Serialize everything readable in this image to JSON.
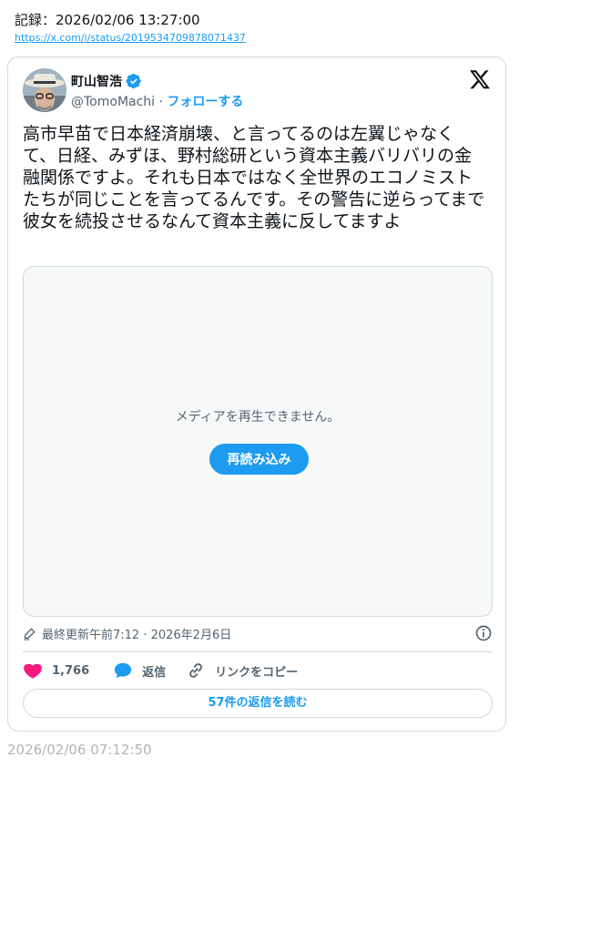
{
  "record": {
    "header": "記録：2026/02/06 13:27:00",
    "url": "https://x.com/i/status/2019534709878071437"
  },
  "tweet": {
    "author_name": "町山智浩",
    "handle": "@TomoMachi",
    "separator": "·",
    "follow_label": "フォローする",
    "text": "高市早苗で日本経済崩壊、と言ってるのは左翼じゃなくて、日経、みずほ、野村総研という資本主義バリバリの金融関係ですよ。それも日本ではなく全世界のエコノミストたちが同じことを言ってるんです。その警告に逆らってまで彼女を続投させるなんて資本主義に反してますよ",
    "media": {
      "message": "メディアを再生できません。",
      "reload_label": "再読み込み"
    },
    "meta": "最終更新午前7:12 · 2026年2月6日",
    "actions": {
      "like_count": "1,766",
      "reply_label": "返信",
      "copy_link_label": "リンクをコピー"
    },
    "read_replies_label": "57件の返信を読む"
  },
  "footer_timestamp": "2026/02/06 07:12:50",
  "colors": {
    "accent": "#1d9bf0",
    "like": "#f91880",
    "muted_text": "#536471",
    "border": "#cfd9de"
  },
  "icons": [
    "verified-badge-icon",
    "x-logo-icon",
    "pencil-icon",
    "info-icon",
    "heart-icon",
    "reply-bubble-icon",
    "link-icon"
  ]
}
